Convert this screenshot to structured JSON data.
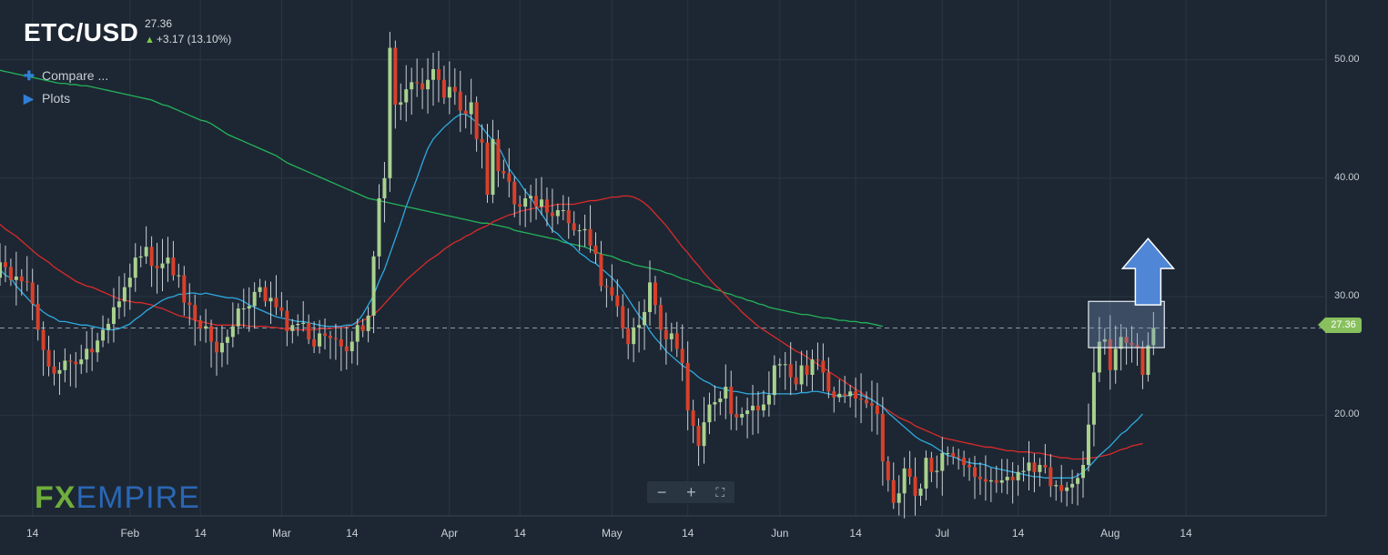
{
  "header": {
    "symbol": "ETC/USD",
    "last_price": "27.36",
    "change": "+3.17 (13.10%)",
    "change_arrow": "up-arrow-icon"
  },
  "menu": {
    "compare_label": "Compare ...",
    "plots_label": "Plots"
  },
  "brand": {
    "fx": "FX",
    "empire": "EMPIRE"
  },
  "price_tag": "27.36",
  "colors": {
    "background": "#1d2733",
    "grid": "#2a3643",
    "bull": "#a9d18e",
    "bear": "#d9402b",
    "ma_fast": "#2ea9df",
    "ma_mid": "#d92a2a",
    "ma_slow": "#24b35a",
    "highlight": "#5b88c8"
  },
  "chart_data": {
    "type": "candlestick",
    "title": "ETC/USD",
    "ylim": [
      11.5,
      53.5
    ],
    "y_ticks": [
      "20.00",
      "30.00",
      "40.00",
      "50.00"
    ],
    "x_tick_labels": [
      "14",
      "Feb",
      "14",
      "Mar",
      "14",
      "Apr",
      "14",
      "May",
      "14",
      "Jun",
      "14",
      "Jul",
      "14",
      "Aug",
      "14"
    ],
    "x_tick_days": [
      14,
      32,
      45,
      60,
      73,
      91,
      104,
      121,
      135,
      152,
      166,
      182,
      196,
      213,
      227
    ],
    "last_price": 27.36,
    "grid": true,
    "candles_close": [
      29.7,
      29.2,
      30.8,
      30.5,
      30.1,
      31.4,
      31.6,
      31.6,
      32.9,
      32.5,
      31.4,
      31.7,
      31.3,
      31.2,
      29.4,
      27.2,
      25.5,
      24.1,
      23.5,
      23.8,
      24.6,
      24.5,
      24.3,
      24.7,
      25.6,
      25.3,
      26.3,
      27.2,
      27.7,
      29.1,
      29.6,
      30.8,
      31.6,
      33.3,
      33.4,
      34.2,
      32.6,
      32.4,
      32.8,
      33.3,
      31.8,
      31.8,
      29.5,
      29.3,
      28.0,
      27.3,
      27.5,
      26.2,
      25.3,
      26.1,
      26.6,
      27.5,
      29.0,
      29.0,
      29.2,
      30.4,
      30.8,
      29.6,
      29.9,
      29.1,
      28.8,
      27.1,
      27.6,
      27.7,
      27.8,
      26.4,
      25.8,
      26.9,
      26.7,
      26.5,
      26.4,
      25.8,
      25.4,
      26.2,
      27.6,
      27.1,
      28.4,
      33.4,
      38.3,
      40.0,
      51.0,
      46.2,
      46.4,
      47.5,
      48.1,
      48.0,
      47.5,
      48.3,
      49.2,
      48.3,
      46.8,
      47.7,
      47.3,
      45.7,
      45.4,
      46.4,
      43.3,
      43.0,
      38.6,
      43.3,
      40.6,
      40.4,
      39.7,
      37.8,
      37.6,
      38.3,
      38.5,
      37.6,
      38.2,
      37.1,
      36.8,
      37.3,
      37.3,
      36.2,
      35.6,
      35.6,
      35.7,
      34.3,
      33.6,
      30.9,
      30.8,
      30.1,
      29.2,
      27.3,
      26.0,
      27.4,
      27.6,
      28.7,
      31.2,
      29.3,
      27.2,
      26.4,
      26.9,
      25.6,
      24.4,
      20.4,
      19.1,
      17.4,
      19.4,
      20.9,
      21.1,
      21.4,
      22.4,
      20.1,
      19.8,
      20.1,
      20.4,
      20.8,
      20.4,
      20.9,
      21.7,
      24.2,
      24.3,
      24.3,
      23.2,
      22.6,
      24.2,
      23.4,
      24.7,
      24.6,
      23.6,
      22.0,
      21.5,
      21.8,
      21.6,
      22.0,
      21.4,
      21.3,
      21.0,
      20.8,
      20.1,
      16.1,
      14.5,
      12.6,
      13.4,
      15.5,
      14.8,
      13.2,
      13.8,
      16.4,
      15.2,
      15.3,
      16.8,
      16.8,
      16.5,
      16.4,
      15.8,
      15.6,
      14.8,
      14.6,
      14.4,
      14.5,
      14.3,
      14.5,
      14.8,
      14.5,
      15.2,
      15.3,
      16.0,
      15.2,
      15.8,
      15.6,
      14.0,
      14.1,
      13.6,
      13.9,
      14.2,
      14.7,
      15.8,
      19.2,
      23.6,
      26.2,
      26.4,
      23.8,
      25.6,
      26.6,
      26.1,
      25.9,
      25.7,
      23.4,
      25.9,
      27.36
    ],
    "ma_fast": [
      34.8,
      34.4,
      34.3,
      34.0,
      33.4,
      32.9,
      32.7,
      32.5,
      32.3,
      31.8,
      31.6,
      30.9,
      30.4,
      29.9,
      29.4,
      29.1,
      28.7,
      28.4,
      28.2,
      27.9,
      27.9,
      27.8,
      27.7,
      27.6,
      27.6,
      27.5,
      27.4,
      27.3,
      27.2,
      27.2,
      27.3,
      27.5,
      27.7,
      28.1,
      28.4,
      28.8,
      29.1,
      29.4,
      29.7,
      29.9,
      30.0,
      30.2,
      30.2,
      30.3,
      30.3,
      30.2,
      30.3,
      30.2,
      30.1,
      30.0,
      29.9,
      29.9,
      29.8,
      29.6,
      29.3,
      29.1,
      28.9,
      28.7,
      28.5,
      28.3,
      28.2,
      28.1,
      28.0,
      27.9,
      27.9,
      27.8,
      27.7,
      27.6,
      27.5,
      27.5,
      27.5,
      27.5,
      27.6,
      27.6,
      27.9,
      28.5,
      29.3,
      30.1,
      31.3,
      32.3,
      33.6,
      34.9,
      36.2,
      37.6,
      38.8,
      40.0,
      41.3,
      42.5,
      43.3,
      43.8,
      44.3,
      44.7,
      45.1,
      45.4,
      45.4,
      45.1,
      44.7,
      44.3,
      43.7,
      43.2,
      42.7,
      41.8,
      40.8,
      40.2,
      39.6,
      38.9,
      38.4,
      37.6,
      37.0,
      36.3,
      35.6,
      35.3,
      34.8,
      34.5,
      34.2,
      33.7,
      33.4,
      33.0,
      32.8,
      32.4,
      32.0,
      31.6,
      31.1,
      30.5,
      29.8,
      29.1,
      28.4,
      27.9,
      27.1,
      26.5,
      26.0,
      25.4,
      25.0,
      24.6,
      24.2,
      23.9,
      23.6,
      23.2,
      22.9,
      22.7,
      22.4,
      22.3,
      22.2,
      22.0,
      22.0,
      21.9,
      21.8,
      21.8,
      21.8,
      21.9,
      21.8,
      21.8,
      21.8,
      21.8,
      21.8,
      21.8,
      21.9,
      21.9,
      22.0,
      22.0,
      21.9,
      21.8,
      21.7,
      21.6,
      21.6,
      21.7,
      21.8,
      21.7,
      21.5,
      21.3,
      21.0,
      20.7,
      20.2,
      19.8,
      19.4,
      19.0,
      18.6,
      18.2,
      17.9,
      17.7,
      17.5,
      17.2,
      16.9,
      16.6,
      16.5,
      16.3,
      16.1,
      16.0,
      15.9,
      15.9,
      15.8,
      15.6,
      15.5,
      15.4,
      15.3,
      15.2,
      15.1,
      15.0,
      14.9,
      14.8,
      14.8,
      14.7,
      14.7,
      14.7,
      14.7,
      14.7,
      14.7,
      14.9,
      15.2,
      15.6,
      16.1,
      16.6,
      17.0,
      17.4,
      17.9,
      18.4,
      18.7,
      19.2,
      19.6,
      20.1
    ],
    "ma_mid": [
      39.0,
      38.6,
      38.1,
      37.7,
      37.3,
      36.9,
      36.6,
      36.4,
      36.1,
      35.7,
      35.4,
      35.1,
      34.7,
      34.3,
      33.9,
      33.5,
      33.2,
      32.9,
      32.5,
      32.2,
      31.9,
      31.6,
      31.3,
      31.1,
      30.9,
      30.8,
      30.6,
      30.4,
      30.2,
      30.0,
      29.8,
      29.7,
      29.6,
      29.5,
      29.5,
      29.4,
      29.3,
      29.1,
      29.0,
      28.8,
      28.6,
      28.4,
      28.3,
      28.2,
      28.0,
      27.9,
      27.8,
      27.7,
      27.6,
      27.6,
      27.6,
      27.6,
      27.6,
      27.6,
      27.5,
      27.5,
      27.5,
      27.5,
      27.4,
      27.4,
      27.3,
      27.3,
      27.2,
      27.2,
      27.2,
      27.2,
      27.2,
      27.3,
      27.3,
      27.3,
      27.4,
      27.4,
      27.4,
      27.6,
      27.8,
      28.0,
      28.2,
      28.5,
      28.9,
      29.4,
      29.9,
      30.4,
      30.9,
      31.4,
      31.8,
      32.2,
      32.6,
      33.0,
      33.3,
      33.6,
      34.0,
      34.3,
      34.6,
      34.8,
      35.1,
      35.3,
      35.6,
      35.8,
      36.0,
      36.3,
      36.5,
      36.7,
      36.9,
      37.0,
      37.2,
      37.3,
      37.4,
      37.5,
      37.6,
      37.6,
      37.7,
      37.8,
      37.8,
      37.8,
      37.8,
      37.9,
      38.0,
      38.1,
      38.1,
      38.2,
      38.3,
      38.4,
      38.4,
      38.5,
      38.5,
      38.4,
      38.2,
      37.9,
      37.5,
      37.0,
      36.5,
      36.0,
      35.4,
      34.8,
      34.2,
      33.7,
      33.1,
      32.6,
      32.0,
      31.5,
      31.0,
      30.6,
      30.1,
      29.6,
      29.2,
      28.7,
      28.3,
      27.9,
      27.5,
      27.2,
      26.9,
      26.6,
      26.3,
      26.0,
      25.7,
      25.4,
      25.2,
      24.9,
      24.6,
      24.3,
      24.0,
      23.7,
      23.4,
      23.1,
      22.8,
      22.5,
      22.2,
      21.9,
      21.6,
      21.3,
      21.0,
      20.7,
      20.4,
      20.1,
      19.8,
      19.6,
      19.4,
      19.1,
      18.9,
      18.7,
      18.5,
      18.3,
      18.1,
      18.0,
      17.9,
      17.8,
      17.7,
      17.6,
      17.5,
      17.4,
      17.3,
      17.3,
      17.2,
      17.1,
      17.0,
      17.0,
      16.9,
      16.9,
      16.9,
      16.8,
      16.8,
      16.7,
      16.6,
      16.5,
      16.4,
      16.4,
      16.3,
      16.3,
      16.3,
      16.4,
      16.4,
      16.5,
      16.6,
      16.7,
      16.9,
      17.1,
      17.2,
      17.4,
      17.5,
      17.6
    ],
    "ma_slow": [
      50.0,
      49.9,
      49.8,
      49.7,
      49.6,
      49.5,
      49.3,
      49.2,
      49.1,
      49.0,
      48.9,
      48.8,
      48.7,
      48.6,
      48.5,
      48.4,
      48.3,
      48.2,
      48.1,
      48.0,
      48.0,
      47.9,
      47.9,
      47.8,
      47.8,
      47.7,
      47.6,
      47.5,
      47.4,
      47.3,
      47.2,
      47.1,
      47.0,
      46.9,
      46.8,
      46.7,
      46.6,
      46.4,
      46.2,
      46.1,
      45.9,
      45.7,
      45.5,
      45.3,
      45.1,
      44.9,
      44.8,
      44.6,
      44.3,
      44.0,
      43.7,
      43.5,
      43.3,
      43.1,
      42.9,
      42.7,
      42.5,
      42.3,
      42.1,
      41.9,
      41.6,
      41.3,
      41.1,
      40.9,
      40.7,
      40.5,
      40.3,
      40.1,
      39.9,
      39.7,
      39.5,
      39.3,
      39.1,
      38.9,
      38.7,
      38.5,
      38.3,
      38.2,
      38.1,
      38.0,
      37.9,
      37.8,
      37.7,
      37.6,
      37.5,
      37.4,
      37.3,
      37.2,
      37.1,
      37.0,
      36.9,
      36.8,
      36.7,
      36.6,
      36.5,
      36.4,
      36.3,
      36.2,
      36.2,
      36.1,
      36.0,
      35.9,
      35.8,
      35.6,
      35.5,
      35.4,
      35.3,
      35.2,
      35.1,
      35.0,
      34.9,
      34.8,
      34.6,
      34.5,
      34.4,
      34.3,
      34.2,
      34.0,
      33.8,
      33.6,
      33.5,
      33.4,
      33.2,
      33.0,
      32.9,
      32.7,
      32.6,
      32.5,
      32.4,
      32.3,
      32.2,
      32.0,
      31.9,
      31.7,
      31.5,
      31.4,
      31.2,
      31.1,
      30.9,
      30.8,
      30.6,
      30.5,
      30.3,
      30.2,
      30.0,
      29.9,
      29.7,
      29.6,
      29.4,
      29.3,
      29.1,
      29.0,
      28.9,
      28.8,
      28.7,
      28.6,
      28.5,
      28.5,
      28.4,
      28.3,
      28.2,
      28.2,
      28.1,
      28.0,
      28.0,
      27.9,
      27.9,
      27.8,
      27.8,
      27.7,
      27.6,
      27.5
    ],
    "annotations": [
      {
        "type": "range_box",
        "day": [
          209,
          223
        ],
        "price": [
          25.7,
          29.6
        ]
      },
      {
        "type": "up_arrow",
        "day": 220,
        "price_base": 29.3,
        "price_tip": 34.9
      }
    ]
  }
}
